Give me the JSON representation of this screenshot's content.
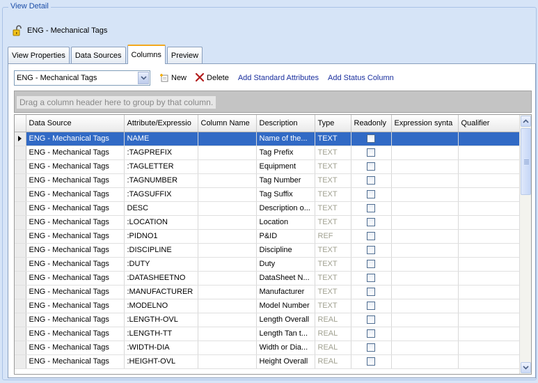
{
  "groupbox": {
    "title": "View Detail"
  },
  "view": {
    "name": "ENG - Mechanical Tags",
    "icon": "open-lock-icon"
  },
  "tabs": [
    {
      "label": "View Properties",
      "active": false
    },
    {
      "label": "Data Sources",
      "active": false
    },
    {
      "label": "Columns",
      "active": true
    },
    {
      "label": "Preview",
      "active": false
    }
  ],
  "toolbar": {
    "datasource_value": "ENG - Mechanical Tags",
    "new_label": "New",
    "delete_label": "Delete",
    "add_standard_label": "Add Standard Attributes",
    "add_status_label": "Add Status Column"
  },
  "group_hint": "Drag a column header here to group by that column.",
  "grid": {
    "columns": [
      "Data Source",
      "Attribute/Expressio",
      "Column Name",
      "Description",
      "Type",
      "Readonly",
      "Expression synta",
      "Qualifier"
    ],
    "rows": [
      {
        "source": "ENG - Mechanical Tags",
        "attribute": "NAME",
        "column_name": "",
        "description": "Name of the...",
        "type": "TEXT",
        "selected": true
      },
      {
        "source": "ENG - Mechanical Tags",
        "attribute": ":TAGPREFIX",
        "column_name": "",
        "description": "Tag Prefix",
        "type": "TEXT"
      },
      {
        "source": "ENG - Mechanical Tags",
        "attribute": ":TAGLETTER",
        "column_name": "",
        "description": "Equipment",
        "type": "TEXT"
      },
      {
        "source": "ENG - Mechanical Tags",
        "attribute": ":TAGNUMBER",
        "column_name": "",
        "description": "Tag Number",
        "type": "TEXT"
      },
      {
        "source": "ENG - Mechanical Tags",
        "attribute": ":TAGSUFFIX",
        "column_name": "",
        "description": "Tag Suffix",
        "type": "TEXT"
      },
      {
        "source": "ENG - Mechanical Tags",
        "attribute": "DESC",
        "column_name": "",
        "description": "Description o...",
        "type": "TEXT"
      },
      {
        "source": "ENG - Mechanical Tags",
        "attribute": ":LOCATION",
        "column_name": "",
        "description": "Location",
        "type": "TEXT"
      },
      {
        "source": "ENG - Mechanical Tags",
        "attribute": ":PIDNO1",
        "column_name": "",
        "description": "P&ID",
        "type": "REF"
      },
      {
        "source": "ENG - Mechanical Tags",
        "attribute": ":DISCIPLINE",
        "column_name": "",
        "description": "Discipline",
        "type": "TEXT"
      },
      {
        "source": "ENG - Mechanical Tags",
        "attribute": ":DUTY",
        "column_name": "",
        "description": "Duty",
        "type": "TEXT"
      },
      {
        "source": "ENG - Mechanical Tags",
        "attribute": ":DATASHEETNO",
        "column_name": "",
        "description": "DataSheet N...",
        "type": "TEXT"
      },
      {
        "source": "ENG - Mechanical Tags",
        "attribute": ":MANUFACTURER",
        "column_name": "",
        "description": "Manufacturer",
        "type": "TEXT"
      },
      {
        "source": "ENG - Mechanical Tags",
        "attribute": ":MODELNO",
        "column_name": "",
        "description": "Model Number",
        "type": "TEXT"
      },
      {
        "source": "ENG - Mechanical Tags",
        "attribute": ":LENGTH-OVL",
        "column_name": "",
        "description": "Length Overall",
        "type": "REAL"
      },
      {
        "source": "ENG - Mechanical Tags",
        "attribute": ":LENGTH-TT",
        "column_name": "",
        "description": "Length Tan t...",
        "type": "REAL"
      },
      {
        "source": "ENG - Mechanical Tags",
        "attribute": ":WIDTH-DIA",
        "column_name": "",
        "description": "Width or Dia...",
        "type": "REAL"
      },
      {
        "source": "ENG - Mechanical Tags",
        "attribute": ":HEIGHT-OVL",
        "column_name": "",
        "description": "Height Overall",
        "type": "REAL"
      }
    ]
  }
}
